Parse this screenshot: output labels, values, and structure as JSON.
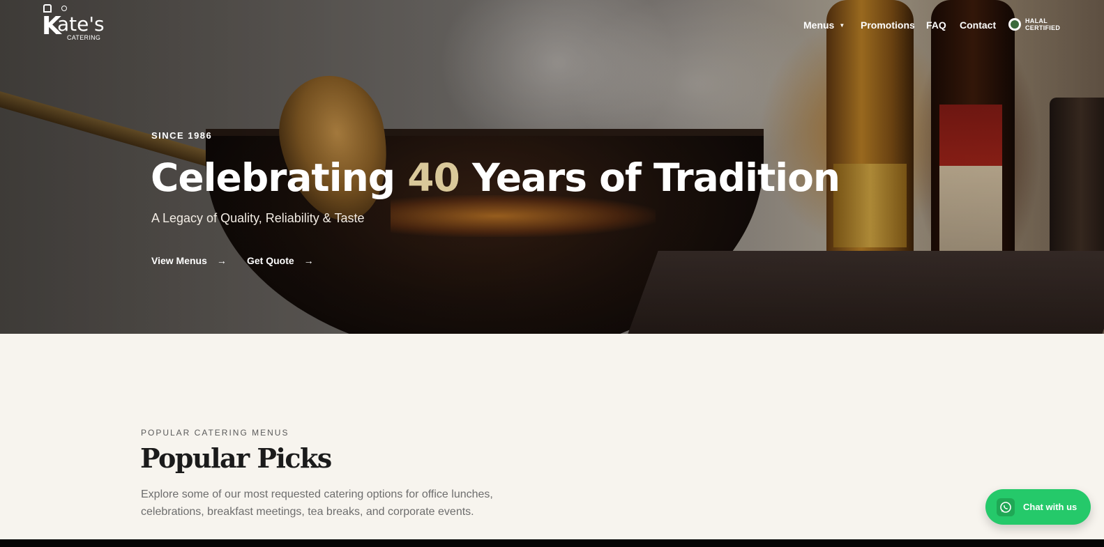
{
  "brand": {
    "logo_text": "Kate's",
    "logo_sub": "CATERING",
    "logo_k": "K"
  },
  "nav": {
    "items": [
      {
        "label": "Menus",
        "has_dropdown": true
      },
      {
        "label": "Promotions"
      },
      {
        "label": "FAQ"
      },
      {
        "label": "Contact"
      }
    ],
    "badge_line1": "HALAL",
    "badge_line2": "CERTIFIED"
  },
  "hero": {
    "eyebrow": "SINCE 1986",
    "title_before": "Celebrating ",
    "title_accent": "40",
    "title_after": " Years of Tradition",
    "subtitle": "A Legacy of Quality, Reliability & Taste",
    "cta_primary": "View Menus",
    "cta_secondary": "Get Quote",
    "arrow": "→"
  },
  "section": {
    "eyebrow": "POPULAR CATERING MENUS",
    "title": "Popular Picks",
    "description": "Explore some of our most requested catering options for office lunches, celebrations, breakfast meetings, tea breaks, and corporate events."
  },
  "chat": {
    "label": "Chat with us",
    "icon": "whatsapp-icon"
  },
  "colors": {
    "accent_gold": "#d9c89a",
    "section_bg": "#f7f4ee",
    "whatsapp_green": "#25c96a"
  }
}
